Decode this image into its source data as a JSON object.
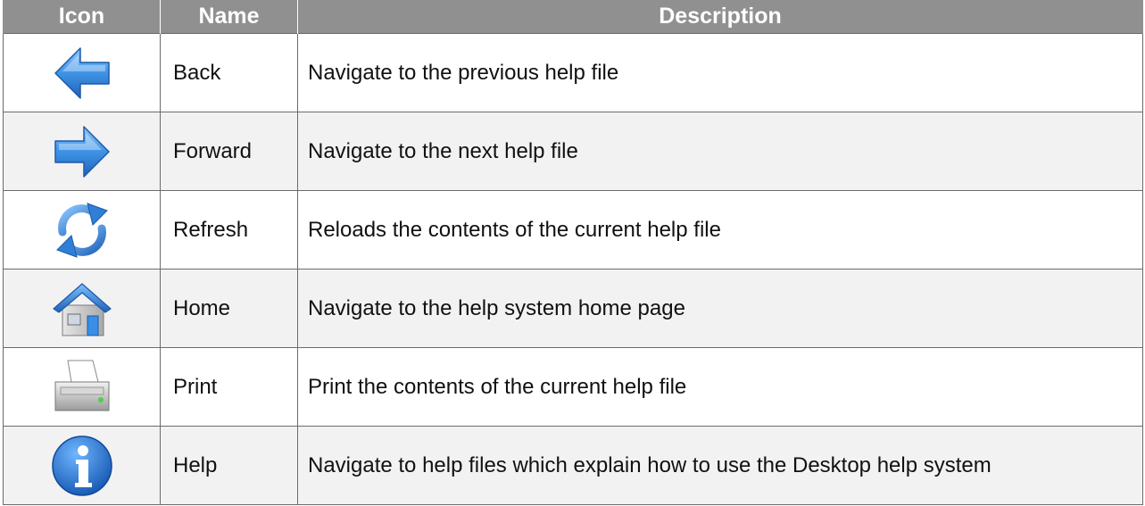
{
  "headers": {
    "icon": "Icon",
    "name": "Name",
    "description": "Description"
  },
  "rows": [
    {
      "icon": "back-arrow-icon",
      "name": "Back",
      "description": "Navigate to the previous help file"
    },
    {
      "icon": "forward-arrow-icon",
      "name": "Forward",
      "description": "Navigate to the next help file"
    },
    {
      "icon": "refresh-icon",
      "name": "Refresh",
      "description": "Reloads the contents of the current help file"
    },
    {
      "icon": "home-icon",
      "name": "Home",
      "description": "Navigate to the help system home page"
    },
    {
      "icon": "printer-icon",
      "name": "Print",
      "description": "Print the contents of the current help file"
    },
    {
      "icon": "info-icon",
      "name": "Help",
      "description": "Navigate to help files which explain how to use the Desktop help system"
    }
  ],
  "colors": {
    "header_bg": "#909090",
    "alt_row_bg": "#f2f2f2",
    "icon_blue": "#2f7fd6"
  }
}
